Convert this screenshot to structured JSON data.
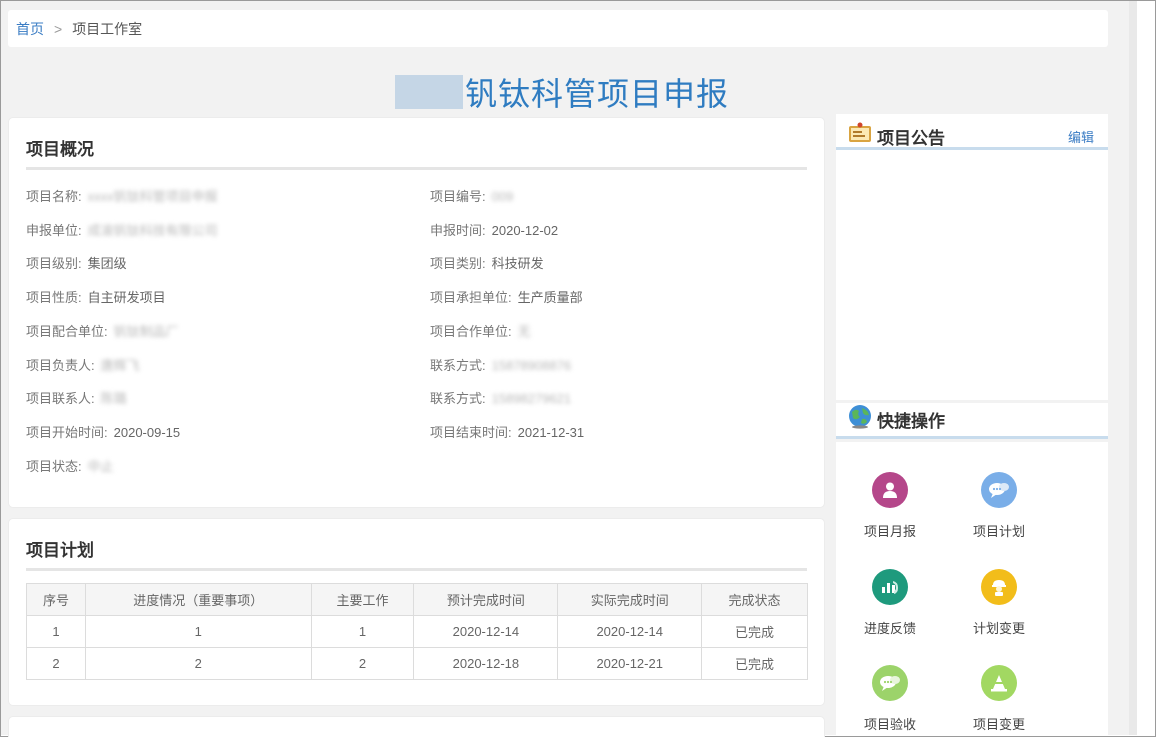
{
  "breadcrumb": {
    "home": "首页",
    "separator": ">",
    "current": "项目工作室"
  },
  "page_title": "钒钛科管项目申报",
  "overview": {
    "title": "项目概况",
    "left": [
      {
        "label": "项目名称:",
        "value": "xxxx钒钛科管项目申报",
        "blurred": true
      },
      {
        "label": "申报单位:",
        "value": "成渝钒钛科技有限公司",
        "blurred": true
      },
      {
        "label": "项目级别:",
        "value": "集团级",
        "blurred": false
      },
      {
        "label": "项目性质:",
        "value": "自主研发项目",
        "blurred": false
      },
      {
        "label": "项目配合单位:",
        "value": "钒钛制品厂",
        "blurred": true
      },
      {
        "label": "项目负责人:",
        "value": "唐辉飞",
        "blurred": true
      },
      {
        "label": "项目联系人:",
        "value": "陈璐",
        "blurred": true
      },
      {
        "label": "项目开始时间:",
        "value": "2020-09-15",
        "blurred": false
      },
      {
        "label": "项目状态:",
        "value": "中止",
        "blurred": true
      }
    ],
    "right": [
      {
        "label": "项目编号:",
        "value": "009",
        "blurred": true
      },
      {
        "label": "申报时间:",
        "value": "2020-12-02",
        "blurred": false
      },
      {
        "label": "项目类别:",
        "value": "科技研发",
        "blurred": false
      },
      {
        "label": "项目承担单位:",
        "value": "生产质量部",
        "blurred": false
      },
      {
        "label": "项目合作单位:",
        "value": "无",
        "blurred": true
      },
      {
        "label": "联系方式:",
        "value": "15878908876",
        "blurred": true
      },
      {
        "label": "联系方式:",
        "value": "15898279621",
        "blurred": true
      },
      {
        "label": "项目结束时间:",
        "value": "2021-12-31",
        "blurred": false
      }
    ]
  },
  "plan": {
    "title": "项目计划",
    "columns": [
      "序号",
      "进度情况（重要事项）",
      "主要工作",
      "预计完成时间",
      "实际完成时间",
      "完成状态"
    ],
    "rows": [
      [
        "1",
        "1",
        "1",
        "2020-12-14",
        "2020-12-14",
        "已完成"
      ],
      [
        "2",
        "2",
        "2",
        "2020-12-18",
        "2020-12-21",
        "已完成"
      ]
    ]
  },
  "notice": {
    "title": "项目公告",
    "edit_label": "编辑",
    "icon": "notice-board-icon"
  },
  "quick": {
    "title": "快捷操作",
    "icon": "globe-icon",
    "items": [
      {
        "label": "项目月报",
        "color": "#b5478a",
        "icon": "person-icon"
      },
      {
        "label": "项目计划",
        "color": "#7aaee8",
        "icon": "chat-bubble-icon"
      },
      {
        "label": "进度反馈",
        "color": "#1e9a7d",
        "icon": "chart-hand-icon"
      },
      {
        "label": "计划变更",
        "color": "#f2bd1a",
        "icon": "worker-icon"
      },
      {
        "label": "项目验收",
        "color": "#9cd36a",
        "icon": "chat-bubble-icon"
      },
      {
        "label": "项目变更",
        "color": "#a2d862",
        "icon": "cone-icon"
      }
    ]
  }
}
